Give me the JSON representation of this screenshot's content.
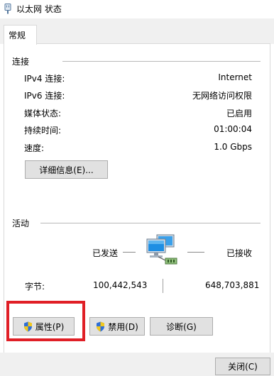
{
  "window": {
    "title": "以太网 状态"
  },
  "tabs": [
    {
      "label": "常规"
    }
  ],
  "connection": {
    "group_label": "连接",
    "rows": [
      {
        "label": "IPv4 连接:",
        "value": "Internet"
      },
      {
        "label": "IPv6 连接:",
        "value": "无网络访问权限"
      },
      {
        "label": "媒体状态:",
        "value": "已启用"
      },
      {
        "label": "持续时间:",
        "value": "01:00:04"
      },
      {
        "label": "速度:",
        "value": "1.0 Gbps"
      }
    ],
    "details_button": "详细信息(E)..."
  },
  "activity": {
    "group_label": "活动",
    "sent_label": "已发送",
    "received_label": "已接收",
    "bytes_label": "字节:",
    "bytes_sent": "100,442,543",
    "bytes_received": "648,703,881"
  },
  "buttons": {
    "properties": "属性(P)",
    "disable": "禁用(D)",
    "diagnose": "诊断(G)",
    "close": "关闭(C)"
  },
  "colors": {
    "highlight": "#e01f26",
    "shield_blue": "#2f6fd6",
    "shield_yellow": "#f2c81e",
    "monitor_blue": "#1e8ee3"
  },
  "icons": {
    "title": "network-adapter-icon",
    "activity": "network-computers-icon",
    "shield": "uac-shield-icon"
  }
}
